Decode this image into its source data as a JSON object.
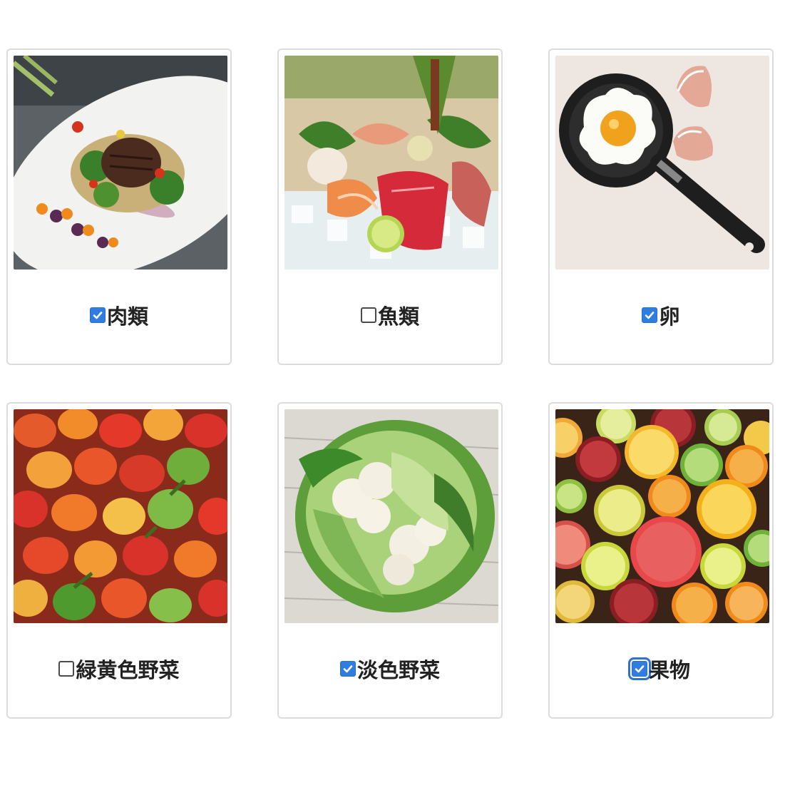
{
  "options": [
    {
      "label": "肉類",
      "checked": true,
      "photo": "steak-dish",
      "focused": false
    },
    {
      "label": "魚類",
      "checked": false,
      "photo": "sashimi-platter",
      "focused": false
    },
    {
      "label": "卵",
      "checked": true,
      "photo": "fried-egg-pan",
      "focused": false
    },
    {
      "label": "緑黄色野菜",
      "checked": false,
      "photo": "peppers",
      "focused": false
    },
    {
      "label": "淡色野菜",
      "checked": true,
      "photo": "cauliflower",
      "focused": false
    },
    {
      "label": "果物",
      "checked": true,
      "photo": "citrus-halves",
      "focused": true
    }
  ],
  "colors": {
    "checkbox_checked": "#2f7de1",
    "card_border": "#dcdcdc",
    "label_text": "#222222"
  }
}
